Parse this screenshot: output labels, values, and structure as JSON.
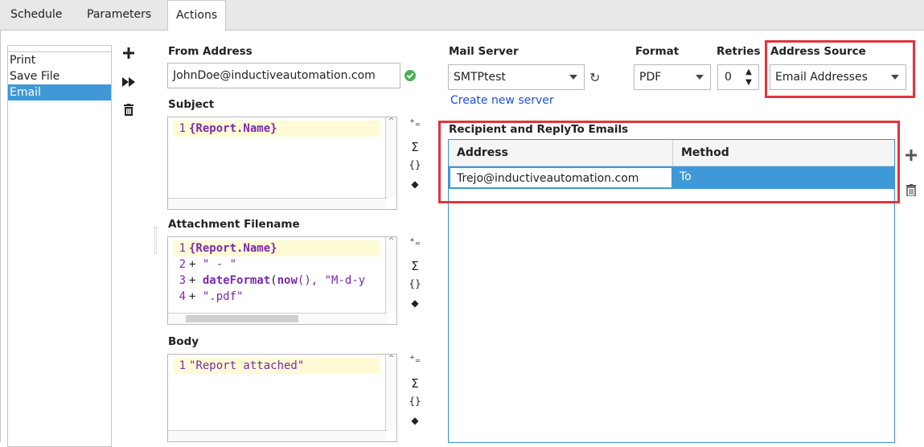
{
  "tabs": [
    {
      "label": "Schedule"
    },
    {
      "label": "Parameters"
    },
    {
      "label": "Actions",
      "active": true
    }
  ],
  "actions": {
    "items": [
      "Print",
      "Save File",
      "Email"
    ],
    "selected": "Email"
  },
  "from_address": {
    "label": "From Address",
    "value": "JohnDoe@inductiveautomation.com"
  },
  "subject": {
    "label": "Subject",
    "lines": [
      {
        "n": "1",
        "text": "{Report.Name}"
      }
    ]
  },
  "attachment": {
    "label": "Attachment Filename",
    "lines": [
      {
        "n": "1",
        "text": "{Report.Name}"
      },
      {
        "n": "2",
        "op": "+",
        "text": "\" - \""
      },
      {
        "n": "3",
        "op": "+",
        "fn": "dateFormat",
        "args_a": "(",
        "fn2": "now",
        "args_b": "(), \"M-d-y"
      },
      {
        "n": "4",
        "op": "+",
        "text": "\".pdf\""
      }
    ]
  },
  "body": {
    "label": "Body",
    "lines": [
      {
        "n": "1",
        "text": "\"Report attached\""
      }
    ]
  },
  "mail_server": {
    "label": "Mail Server",
    "value": "SMTPtest",
    "create_link": "Create new server"
  },
  "format": {
    "label": "Format",
    "value": "PDF"
  },
  "retries": {
    "label": "Retries",
    "value": "0"
  },
  "address_source": {
    "label": "Address Source",
    "value": "Email Addresses"
  },
  "recipients": {
    "label": "Recipient and ReplyTo Emails",
    "columns": [
      "Address",
      "Method"
    ],
    "rows": [
      {
        "address": "Trejo@inductiveautomation.com",
        "method": "To"
      }
    ]
  },
  "colors": {
    "accent": "#3f98d8",
    "highlight_box": "#e0353d",
    "link": "#1a55c9",
    "code_keyword": "#7a2aa8",
    "valid_check": "#4caf50"
  }
}
